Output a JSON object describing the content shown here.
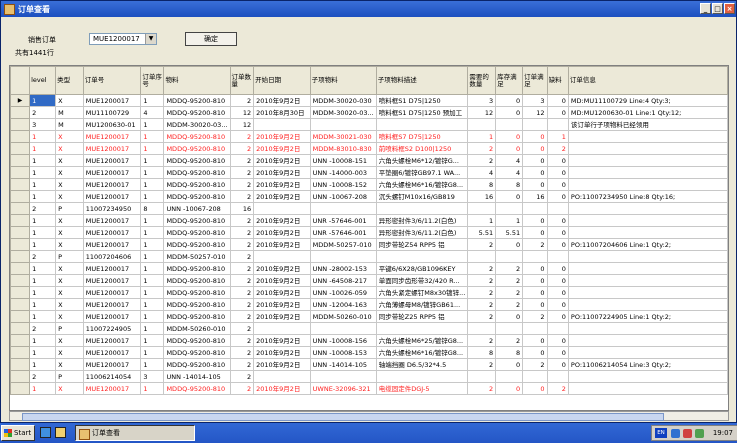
{
  "window": {
    "title": "订单查看",
    "min": "_",
    "max": "□",
    "close": "×"
  },
  "form": {
    "order_label": "销售订单",
    "order_value": "MUE1200017",
    "confirm": "确定",
    "total": "共有1441行"
  },
  "columns": [
    "level",
    "类型",
    "订单号",
    "订单序号",
    "物料",
    "订单数量",
    "开始日期",
    "子项物料",
    "子项物料描述",
    "需要的数量",
    "库存满足",
    "订单满足",
    "缺料",
    "订单信息"
  ],
  "rows": [
    {
      "red": false,
      "cells": [
        "1",
        "X",
        "MUE1200017",
        "1",
        "MDDQ-95200-810",
        "2",
        "2010年9月2日",
        "MDDM-30020-030",
        "喷料框S1 D75|1250",
        "3",
        "0",
        "3",
        "0",
        "MD:MU11100729 Line:4 Qty:3;"
      ]
    },
    {
      "red": false,
      "cells": [
        "2",
        "M",
        "MU11100729",
        "4",
        "MDDQ-95200-810",
        "12",
        "2010年8月30日",
        "MDDM-30020-03...",
        "喷料框S1 D75|1250 预加工",
        "12",
        "0",
        "12",
        "0",
        "MD:MU1200630-01 Line:1 Qty:12;"
      ]
    },
    {
      "red": false,
      "cells": [
        "3",
        "M",
        "MU1200630-01",
        "1",
        "MDDM-30020-03...",
        "12",
        "",
        "",
        "",
        "",
        "",
        "",
        "",
        "该订单行子项物料已经领用"
      ]
    },
    {
      "red": true,
      "cells": [
        "1",
        "X",
        "MUE1200017",
        "1",
        "MDDQ-95200-810",
        "2",
        "2010年9月2日",
        "MDDM-30021-030",
        "喷料框S7 D75|1250",
        "1",
        "0",
        "0",
        "1",
        ""
      ]
    },
    {
      "red": true,
      "cells": [
        "1",
        "X",
        "MUE1200017",
        "1",
        "MDDQ-95200-810",
        "2",
        "2010年9月2日",
        "MDDM-83010-830",
        "前喷料框S2 D100|1250",
        "2",
        "0",
        "0",
        "2",
        ""
      ]
    },
    {
      "red": false,
      "cells": [
        "1",
        "X",
        "MUE1200017",
        "1",
        "MDDQ-95200-810",
        "2",
        "2010年9月2日",
        "UNN -10008-151",
        "六角头螺栓M6*12/镀锌G...",
        "2",
        "4",
        "0",
        "0",
        ""
      ]
    },
    {
      "red": false,
      "cells": [
        "1",
        "X",
        "MUE1200017",
        "1",
        "MDDQ-95200-810",
        "2",
        "2010年9月2日",
        "UNN -14000-003",
        "平垫圈6/镀锌GB97.1 WA...",
        "4",
        "4",
        "0",
        "0",
        ""
      ]
    },
    {
      "red": false,
      "cells": [
        "1",
        "X",
        "MUE1200017",
        "1",
        "MDDQ-95200-810",
        "2",
        "2010年9月2日",
        "UNN -10008-152",
        "六角头螺栓M6*16/镀锌G8...",
        "8",
        "8",
        "0",
        "0",
        ""
      ]
    },
    {
      "red": false,
      "cells": [
        "1",
        "X",
        "MUE1200017",
        "1",
        "MDDQ-95200-810",
        "2",
        "2010年9月2日",
        "UNN -10067-208",
        "沉头螺钉M10x16/GB819",
        "16",
        "0",
        "16",
        "0",
        "PO:11007234950 Line:8 Qty:16;"
      ]
    },
    {
      "red": false,
      "cells": [
        "2",
        "P",
        "11007234950",
        "8",
        "UNN -10067-208",
        "16",
        "",
        "",
        "",
        "",
        "",
        "",
        "",
        ""
      ]
    },
    {
      "red": false,
      "cells": [
        "1",
        "X",
        "MUE1200017",
        "1",
        "MDDQ-95200-810",
        "2",
        "2010年9月2日",
        "UNR -57646-001",
        "异形密封件3/6/11.2(白色)",
        "1",
        "1",
        "0",
        "0",
        ""
      ]
    },
    {
      "red": false,
      "cells": [
        "1",
        "X",
        "MUE1200017",
        "1",
        "MDDQ-95200-810",
        "2",
        "2010年9月2日",
        "UNR -57646-001",
        "异形密封件3/6/11.2(白色)",
        "5.51",
        "5.51",
        "0",
        "0",
        ""
      ]
    },
    {
      "red": false,
      "cells": [
        "1",
        "X",
        "MUE1200017",
        "1",
        "MDDQ-95200-810",
        "2",
        "2010年9月2日",
        "MDDM-50257-010",
        "同步带轮Z54 RPP5 铝",
        "2",
        "0",
        "2",
        "0",
        "PO:11007204606 Line:1 Qty:2;"
      ]
    },
    {
      "red": false,
      "cells": [
        "2",
        "P",
        "11007204606",
        "1",
        "MDDM-50257-010",
        "2",
        "",
        "",
        "",
        "",
        "",
        "",
        "",
        ""
      ]
    },
    {
      "red": false,
      "cells": [
        "1",
        "X",
        "MUE1200017",
        "1",
        "MDDQ-95200-810",
        "2",
        "2010年9月2日",
        "UNN -28002-153",
        "平键6/6X28/GB1096KEY",
        "2",
        "2",
        "0",
        "0",
        ""
      ]
    },
    {
      "red": false,
      "cells": [
        "1",
        "X",
        "MUE1200017",
        "1",
        "MDDQ-95200-810",
        "2",
        "2010年9月2日",
        "UNN -64508-217",
        "单面同步齿形带32/420 R...",
        "2",
        "2",
        "0",
        "0",
        ""
      ]
    },
    {
      "red": false,
      "cells": [
        "1",
        "X",
        "MUE1200017",
        "1",
        "MDDQ-95200-810",
        "2",
        "2010年9月2日",
        "UNN -10026-059",
        "六角头紧定螺钉M8x30镀锌...",
        "2",
        "2",
        "0",
        "0",
        ""
      ]
    },
    {
      "red": false,
      "cells": [
        "1",
        "X",
        "MUE1200017",
        "1",
        "MDDQ-95200-810",
        "2",
        "2010年9月2日",
        "UNN -12004-163",
        "六角薄螺母M8/镀锌GB61...",
        "2",
        "2",
        "0",
        "0",
        ""
      ]
    },
    {
      "red": false,
      "cells": [
        "1",
        "X",
        "MUE1200017",
        "1",
        "MDDQ-95200-810",
        "2",
        "2010年9月2日",
        "MDDM-50260-010",
        "同步带轮Z25 RPP5 铝",
        "2",
        "0",
        "2",
        "0",
        "PO:11007224905 Line:1 Qty:2;"
      ]
    },
    {
      "red": false,
      "cells": [
        "2",
        "P",
        "11007224905",
        "1",
        "MDDM-50260-010",
        "2",
        "",
        "",
        "",
        "",
        "",
        "",
        "",
        ""
      ]
    },
    {
      "red": false,
      "cells": [
        "1",
        "X",
        "MUE1200017",
        "1",
        "MDDQ-95200-810",
        "2",
        "2010年9月2日",
        "UNN -10008-156",
        "六角头螺栓M6*25/镀锌G8...",
        "2",
        "2",
        "0",
        "0",
        ""
      ]
    },
    {
      "red": false,
      "cells": [
        "1",
        "X",
        "MUE1200017",
        "1",
        "MDDQ-95200-810",
        "2",
        "2010年9月2日",
        "UNN -10008-153",
        "六角头螺栓M6*16/镀锌G8...",
        "8",
        "8",
        "0",
        "0",
        ""
      ]
    },
    {
      "red": false,
      "cells": [
        "1",
        "X",
        "MUE1200017",
        "1",
        "MDDQ-95200-810",
        "2",
        "2010年9月2日",
        "UNN -14014-105",
        "轴端挡圈 D6.5/32*4.5",
        "2",
        "0",
        "2",
        "0",
        "PO:11006214054 Line:3 Qty:2;"
      ]
    },
    {
      "red": false,
      "cells": [
        "2",
        "P",
        "11006214054",
        "3",
        "UNN -14014-105",
        "2",
        "",
        "",
        "",
        "",
        "",
        "",
        "",
        ""
      ]
    },
    {
      "red": true,
      "cells": [
        "1",
        "X",
        "MUE1200017",
        "1",
        "MDDQ-95200-810",
        "2",
        "2010年9月2日",
        "UWNE-32096-321",
        "电缆固定件DGJ-5",
        "2",
        "0",
        "0",
        "2",
        ""
      ]
    }
  ],
  "taskbar": {
    "start": "Start",
    "task": "订单查看",
    "lang": "EN",
    "clock": "19:07"
  }
}
